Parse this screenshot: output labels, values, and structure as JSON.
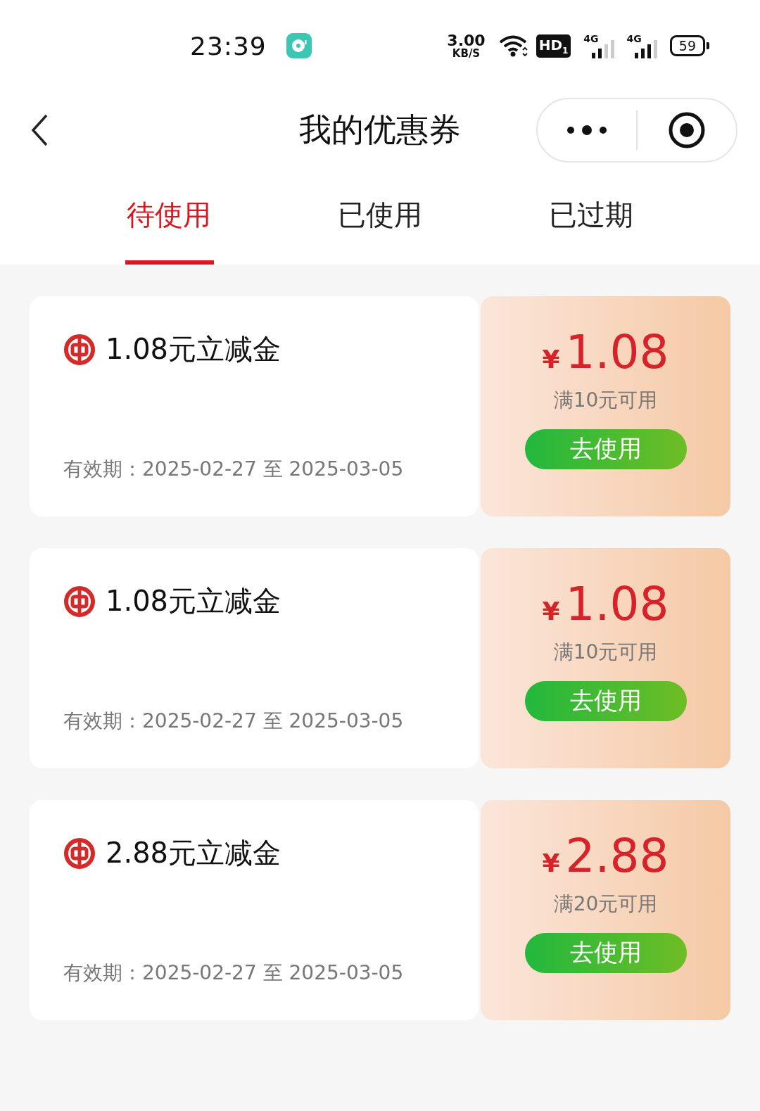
{
  "status_bar": {
    "time": "23:39",
    "speed_value": "3.00",
    "speed_unit": "KB/S",
    "hd_badge": "HD$_{1}$",
    "networks": [
      "4G",
      "4G"
    ],
    "battery": "59"
  },
  "nav": {
    "title": "我的优惠券"
  },
  "tabs": [
    {
      "label": "待使用",
      "selected": true
    },
    {
      "label": "已使用",
      "selected": false
    },
    {
      "label": "已过期",
      "selected": false
    }
  ],
  "coupons": [
    {
      "title": "1.08元立减金",
      "validity": "有效期：2025-02-27 至 2025-03-05",
      "currency": "¥",
      "amount": "1.08",
      "condition": "满10元可用",
      "button": "去使用"
    },
    {
      "title": "1.08元立减金",
      "validity": "有效期：2025-02-27 至 2025-03-05",
      "currency": "¥",
      "amount": "1.08",
      "condition": "满10元可用",
      "button": "去使用"
    },
    {
      "title": "2.88元立减金",
      "validity": "有效期：2025-02-27 至 2025-03-05",
      "currency": "¥",
      "amount": "2.88",
      "condition": "满20元可用",
      "button": "去使用"
    }
  ]
}
